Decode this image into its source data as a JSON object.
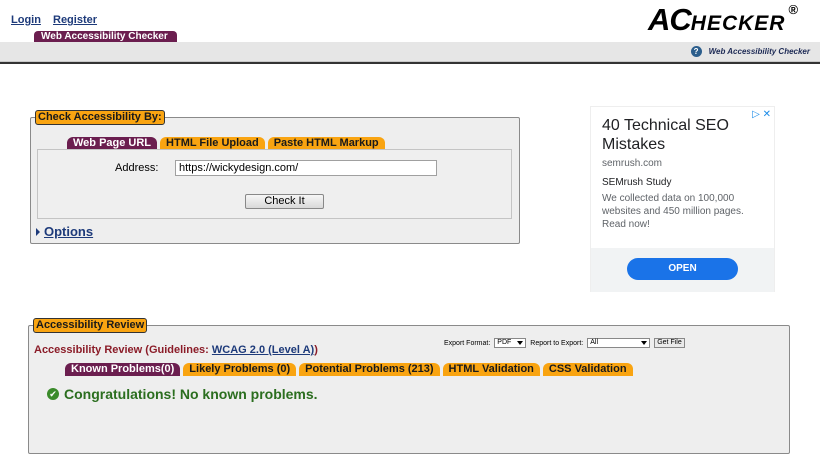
{
  "header": {
    "links": [
      "Login",
      "Register"
    ],
    "logo_big": "AC",
    "logo_rest": "HECKER",
    "logo_mark": "®",
    "brand_tab": "Web Accessibility Checker",
    "help_link": "Web Accessibility Checker"
  },
  "check": {
    "legend": "Check Accessibility By:",
    "tabs": [
      "Web Page URL",
      "HTML File Upload",
      "Paste HTML Markup"
    ],
    "address_label": "Address:",
    "address_value": "https://wickydesign.com/",
    "check_button": "Check It",
    "options_label": "Options"
  },
  "ad": {
    "title": "40 Technical SEO Mistakes",
    "domain": "semrush.com",
    "headline": "SEMrush Study",
    "description": "We collected data on 100,000 websites and 450 million pages. Read now!",
    "cta": "OPEN"
  },
  "review": {
    "legend": "Accessibility Review",
    "heading_prefix": "Accessibility Review (Guidelines: ",
    "guideline_link": "WCAG 2.0 (Level A)",
    "heading_suffix": ")",
    "export_format_label": "Export Format:",
    "export_format_value": "PDF",
    "report_label": "Report to Export:",
    "report_value": "All",
    "get_file": "Get File",
    "tabs": [
      "Known Problems(0)",
      "Likely Problems (0)",
      "Potential Problems (213)",
      "HTML Validation",
      "CSS Validation"
    ],
    "message": "Congratulations! No known problems."
  },
  "colors": {
    "accent_orange": "#f9a411",
    "accent_maroon": "#6b1e4f",
    "link_blue": "#1d3a7a",
    "success_green": "#2b6e1f",
    "ad_button_blue": "#1a73e8"
  }
}
